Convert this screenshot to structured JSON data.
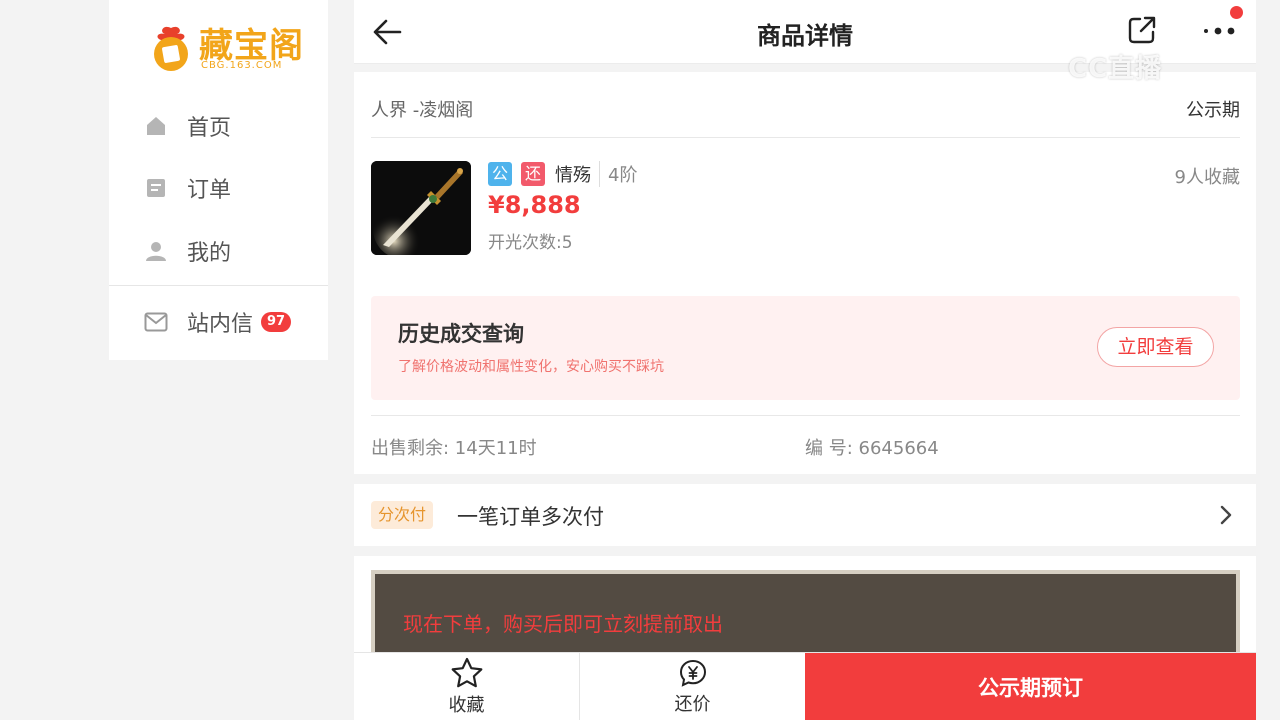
{
  "sidebar": {
    "logo_text": "藏宝阁",
    "logo_sub": "CBG.163.COM",
    "items": [
      {
        "label": "首页",
        "icon": "home-icon"
      },
      {
        "label": "订单",
        "icon": "order-icon"
      },
      {
        "label": "我的",
        "icon": "user-icon"
      }
    ],
    "messages": {
      "label": "站内信",
      "icon": "mail-icon",
      "count": "97"
    }
  },
  "header": {
    "title": "商品详情"
  },
  "watermark": "CC直播",
  "item": {
    "server": "人界 -凌烟阁",
    "status": "公示期",
    "tag_public": "公",
    "tag_bargain": "还",
    "name": "情殇",
    "level": "4阶",
    "collect_count": "9人收藏",
    "price": "¥8,888",
    "open_count": "开光次数:5"
  },
  "history": {
    "title": "历史成交查询",
    "subtitle": "了解价格波动和属性变化，安心购买不踩坑",
    "button": "立即查看"
  },
  "info": {
    "remaining": "出售剩余: 14天11时",
    "serial": "编 号: 6645664"
  },
  "installment": {
    "tag": "分次付",
    "text": "一笔订单多次付"
  },
  "banner": {
    "text": "现在下单，购买后即可立刻提前取出"
  },
  "bottom_bar": {
    "favorite": "收藏",
    "bargain": "还价",
    "preorder": "公示期预订"
  },
  "colors": {
    "accent": "#f23d3d",
    "tag_public": "#4fb3ec",
    "tag_bargain": "#f25a6b",
    "logo": "#f2a51a"
  }
}
